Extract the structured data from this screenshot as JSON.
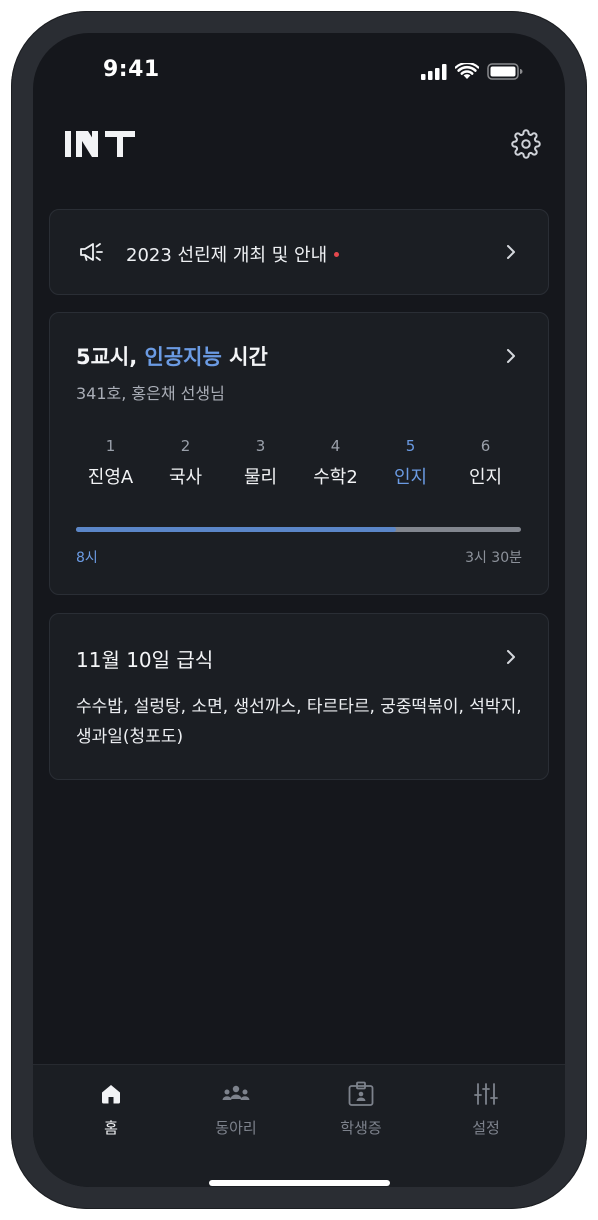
{
  "status": {
    "time": "9:41"
  },
  "header": {
    "logo_text": "INT"
  },
  "notice": {
    "text": "2023 선린제 개최 및 안내"
  },
  "class_card": {
    "title_prefix": "5교시, ",
    "title_subject": "인공지능",
    "title_suffix": " 시간",
    "subtitle": "341호, 홍은채 선생님",
    "periods": [
      {
        "num": "1",
        "subject": "진영A"
      },
      {
        "num": "2",
        "subject": "국사"
      },
      {
        "num": "3",
        "subject": "물리"
      },
      {
        "num": "4",
        "subject": "수학2"
      },
      {
        "num": "5",
        "subject": "인지"
      },
      {
        "num": "6",
        "subject": "인지"
      }
    ],
    "current_period": 5,
    "progress_fraction": 0.72,
    "start_label": "8시",
    "end_label": "3시 30분"
  },
  "meal_card": {
    "title": "11월 10일 급식",
    "menu": "수수밥, 설렁탕, 소면, 생선까스, 타르타르, 궁중떡볶이, 석박지, 생과일(청포도)"
  },
  "tabbar": {
    "tabs": [
      {
        "label": "홈",
        "icon": "home-icon",
        "active": true
      },
      {
        "label": "동아리",
        "icon": "group-icon",
        "active": false
      },
      {
        "label": "학생증",
        "icon": "id-card-icon",
        "active": false
      },
      {
        "label": "설정",
        "icon": "sliders-icon",
        "active": false
      }
    ]
  },
  "colors": {
    "accent": "#6b9be3",
    "background": "#15171c",
    "card": "#1b1e23",
    "badge_red": "#e5484d"
  }
}
